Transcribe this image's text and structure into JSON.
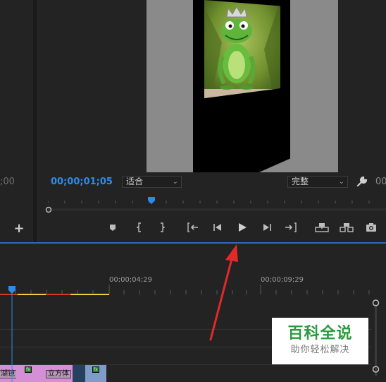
{
  "monitor": {
    "left_timecode": ";00",
    "playhead_timecode": "00;00;01;05",
    "right_timecode": "00",
    "zoom_select": {
      "value": "适合"
    },
    "quality_select": {
      "value": "完整"
    },
    "transport_icons": [
      "add-marker-icon",
      "mark-in-icon",
      "mark-out-icon",
      "go-to-in-icon",
      "step-back-icon",
      "play-icon",
      "step-forward-icon",
      "go-to-out-icon",
      "lift-icon",
      "extract-icon",
      "export-frame-icon"
    ]
  },
  "sidebar": {
    "add_label": "+"
  },
  "timeline": {
    "ruler_labels": [
      "00;00;04;29",
      "00;00;09;29"
    ],
    "clips": [
      {
        "label": "湖镜"
      },
      {
        "label": "立方体"
      },
      {
        "label": ""
      },
      {
        "label": ""
      }
    ],
    "fx_badge": "fx"
  },
  "watermark": {
    "title": "百科全说",
    "subtitle": "助你轻松解决"
  },
  "colors": {
    "accent": "#2d8ceb",
    "arrow": "#e02a2a",
    "watermark_green": "#2a9a3e",
    "clip_pink": "#d58fd5"
  }
}
